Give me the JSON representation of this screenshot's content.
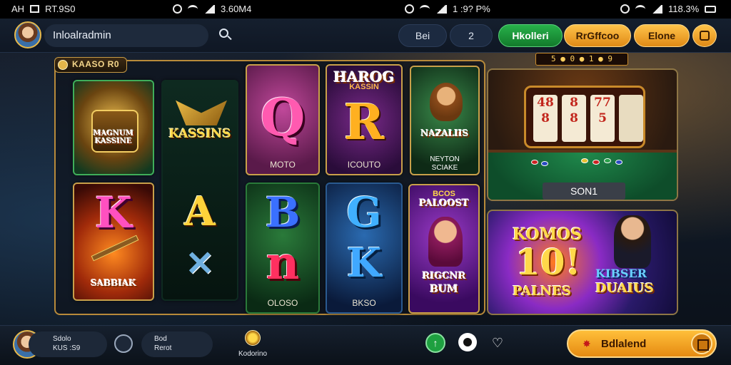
{
  "status_bar": {
    "left": [
      "AH",
      "RT.9S0"
    ],
    "center": "3.60M4",
    "center2": "1 :9? P%",
    "right": "118.3%"
  },
  "header": {
    "search_value": "Inloalradmin",
    "tabs": [
      "Bei",
      "2"
    ],
    "buttons": [
      "Hkolleri",
      "RrGffcoo",
      "Elone"
    ]
  },
  "reel_strip": "5 ● 0 ● 1 ● 9",
  "section": {
    "title": "KAASO R0"
  },
  "tiles": [
    {
      "id": "magnum",
      "banner": "MAGNUM KASSINE",
      "caption": ""
    },
    {
      "id": "kassins",
      "banner": "KASSINS",
      "caption": ""
    },
    {
      "id": "q-card",
      "letter": "Q",
      "caption": "MOTO"
    },
    {
      "id": "r-card",
      "header": "HAROG",
      "header2": "KASSIN",
      "letter": "R",
      "caption": "ICOUTO"
    },
    {
      "id": "warrior",
      "banner": "NAZALIIS",
      "caption": "NEYTON",
      "caption2": "SCIAKE"
    },
    {
      "id": "k-card",
      "letter": "K",
      "banner": "SABBIAK"
    },
    {
      "id": "a-card",
      "letter": "A"
    },
    {
      "id": "b-card",
      "letter": "B",
      "letter2": "n",
      "caption": "OLOSO"
    },
    {
      "id": "g-card",
      "letter": "G",
      "letter2": "K",
      "caption": "BKSO"
    },
    {
      "id": "woman",
      "header": "BCOS",
      "header2": "PALOOST",
      "banner": "RIGCNR",
      "banner2": "BUM"
    }
  ],
  "slot_panel": {
    "label": "SON1",
    "reel_values": [
      [
        "48",
        "8",
        "77"
      ],
      [
        "8",
        "8",
        "5"
      ]
    ]
  },
  "promo": {
    "line1": "KOMOS",
    "line2": "10!",
    "line3": "PALNES",
    "right1": "KIBSER",
    "right2": "DUAIUS"
  },
  "bottom": {
    "user_line1": "Sdolo",
    "user_line2": "KUS :S9",
    "info_line1": "Bod",
    "info_line2": "Rerot",
    "center_label": "Kodorino",
    "cta_label": "Bdlalend"
  },
  "colors": {
    "accent_gold": "#c9a04a",
    "green": "#27b04a",
    "orange": "#ffbf3a"
  }
}
